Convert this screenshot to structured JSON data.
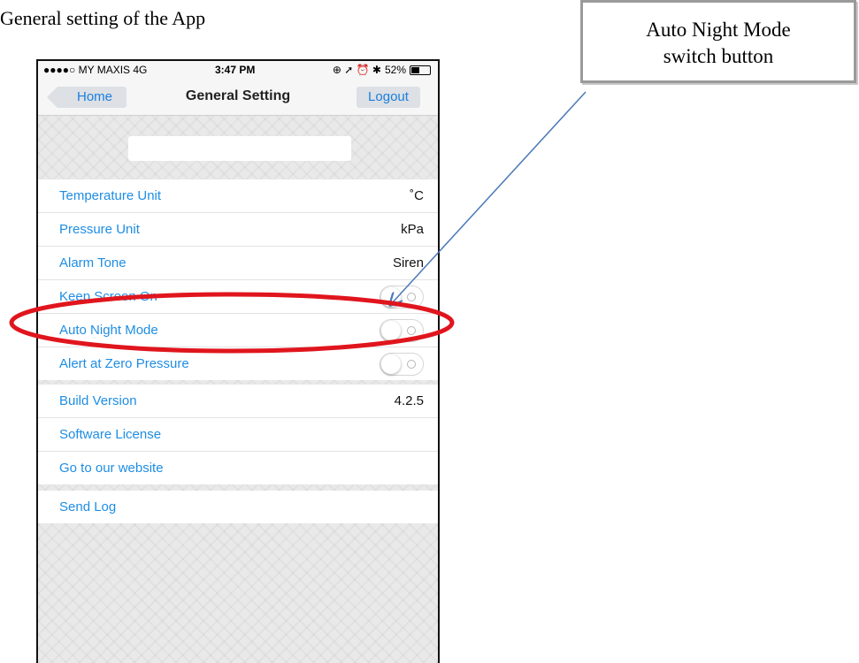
{
  "document": {
    "caption": "General setting of the App",
    "callout_line1": "Auto Night Mode",
    "callout_line2": "switch button",
    "highlight_color": "#e0151d",
    "arrow_color": "#4a78b8"
  },
  "status_bar": {
    "carrier": "●●●●○ MY MAXIS  4G",
    "time": "3:47 PM",
    "indicators": "⊕ ➚ ⏰ ✱",
    "battery": "52%",
    "battery_level": 0.52
  },
  "nav": {
    "back_label": "Home",
    "title": "General Setting",
    "logout_label": "Logout"
  },
  "device_name": {
    "value": ""
  },
  "settings": {
    "temperature_unit": {
      "label": "Temperature Unit",
      "value": "˚C"
    },
    "pressure_unit": {
      "label": "Pressure Unit",
      "value": "kPa"
    },
    "alarm_tone": {
      "label": "Alarm Tone",
      "value": "Siren"
    },
    "keep_screen_on": {
      "label": "Keep Screen On",
      "on": false
    },
    "auto_night_mode": {
      "label": "Auto Night Mode",
      "on": false
    },
    "alert_zero_pressure": {
      "label": "Alert at Zero Pressure",
      "on": false
    }
  },
  "info": {
    "build_version": {
      "label": "Build Version",
      "value": "4.2.5"
    },
    "software_license": {
      "label": "Software License"
    },
    "website": {
      "label": "Go to our website"
    }
  },
  "log": {
    "send_log": {
      "label": "Send Log"
    }
  },
  "colors": {
    "link_blue": "#1e8de3",
    "background_gray": "#e9e9e9"
  }
}
